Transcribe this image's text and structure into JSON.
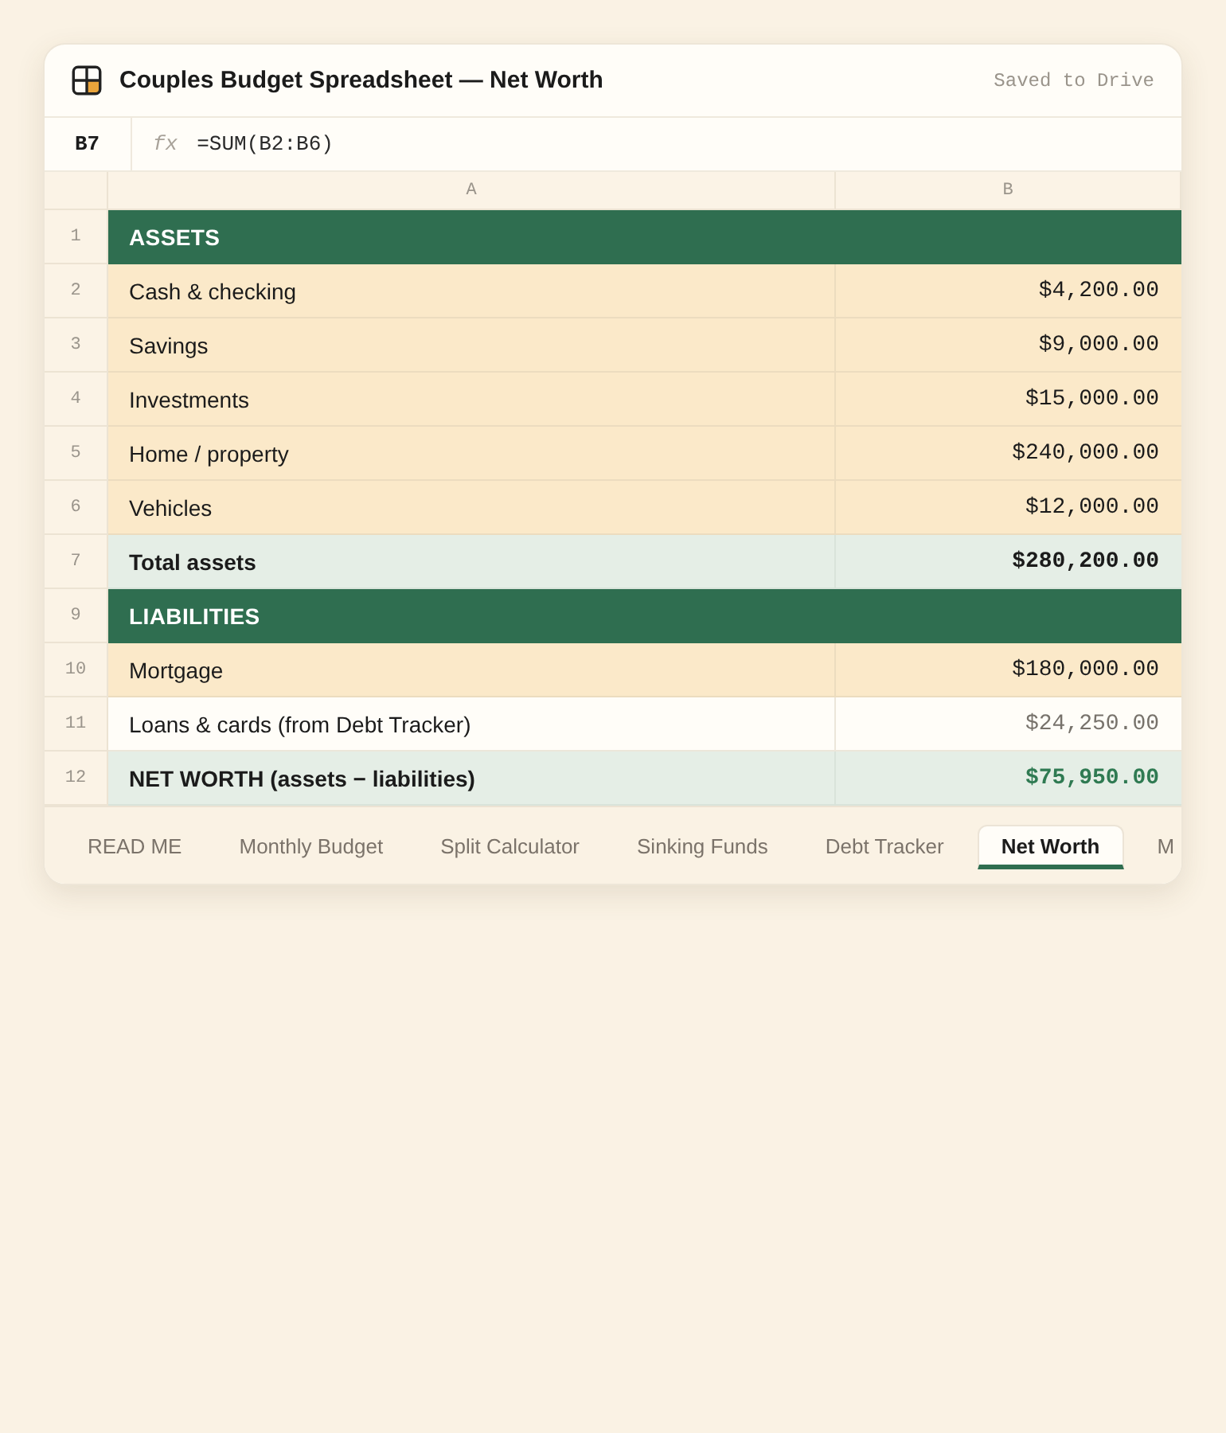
{
  "window": {
    "title": "Couples Budget Spreadsheet — Net Worth",
    "status": "Saved to Drive"
  },
  "formula_bar": {
    "cell": "B7",
    "function_label": "fx",
    "formula": "=SUM(B2:B6)"
  },
  "columns": [
    "A",
    "B"
  ],
  "rows": [
    {
      "number": "1",
      "kind": "section",
      "label": "ASSETS"
    },
    {
      "number": "2",
      "kind": "input",
      "label": "Cash & checking",
      "value": "$4,200.00"
    },
    {
      "number": "3",
      "kind": "input",
      "label": "Savings",
      "value": "$9,000.00"
    },
    {
      "number": "4",
      "kind": "input",
      "label": "Investments",
      "value": "$15,000.00"
    },
    {
      "number": "5",
      "kind": "input",
      "label": "Home / property",
      "value": "$240,000.00"
    },
    {
      "number": "6",
      "kind": "input",
      "label": "Vehicles",
      "value": "$12,000.00"
    },
    {
      "number": "7",
      "kind": "total",
      "label": "Total assets",
      "value": "$280,200.00"
    },
    {
      "number": "9",
      "kind": "section",
      "label": "LIABILITIES"
    },
    {
      "number": "10",
      "kind": "input",
      "label": "Mortgage",
      "value": "$180,000.00"
    },
    {
      "number": "11",
      "kind": "linked",
      "label": "Loans & cards (from Debt Tracker)",
      "value": "$24,250.00"
    },
    {
      "number": "12",
      "kind": "result",
      "label": "NET WORTH (assets − liabilities)",
      "value": "$75,950.00"
    }
  ],
  "sheet_tabs": [
    {
      "label": "READ ME",
      "selected": false
    },
    {
      "label": "Monthly Budget",
      "selected": false
    },
    {
      "label": "Split Calculator",
      "selected": false
    },
    {
      "label": "Sinking Funds",
      "selected": false
    },
    {
      "label": "Debt Tracker",
      "selected": false
    },
    {
      "label": "Net Worth",
      "selected": true
    },
    {
      "label": "M",
      "selected": false
    }
  ]
}
